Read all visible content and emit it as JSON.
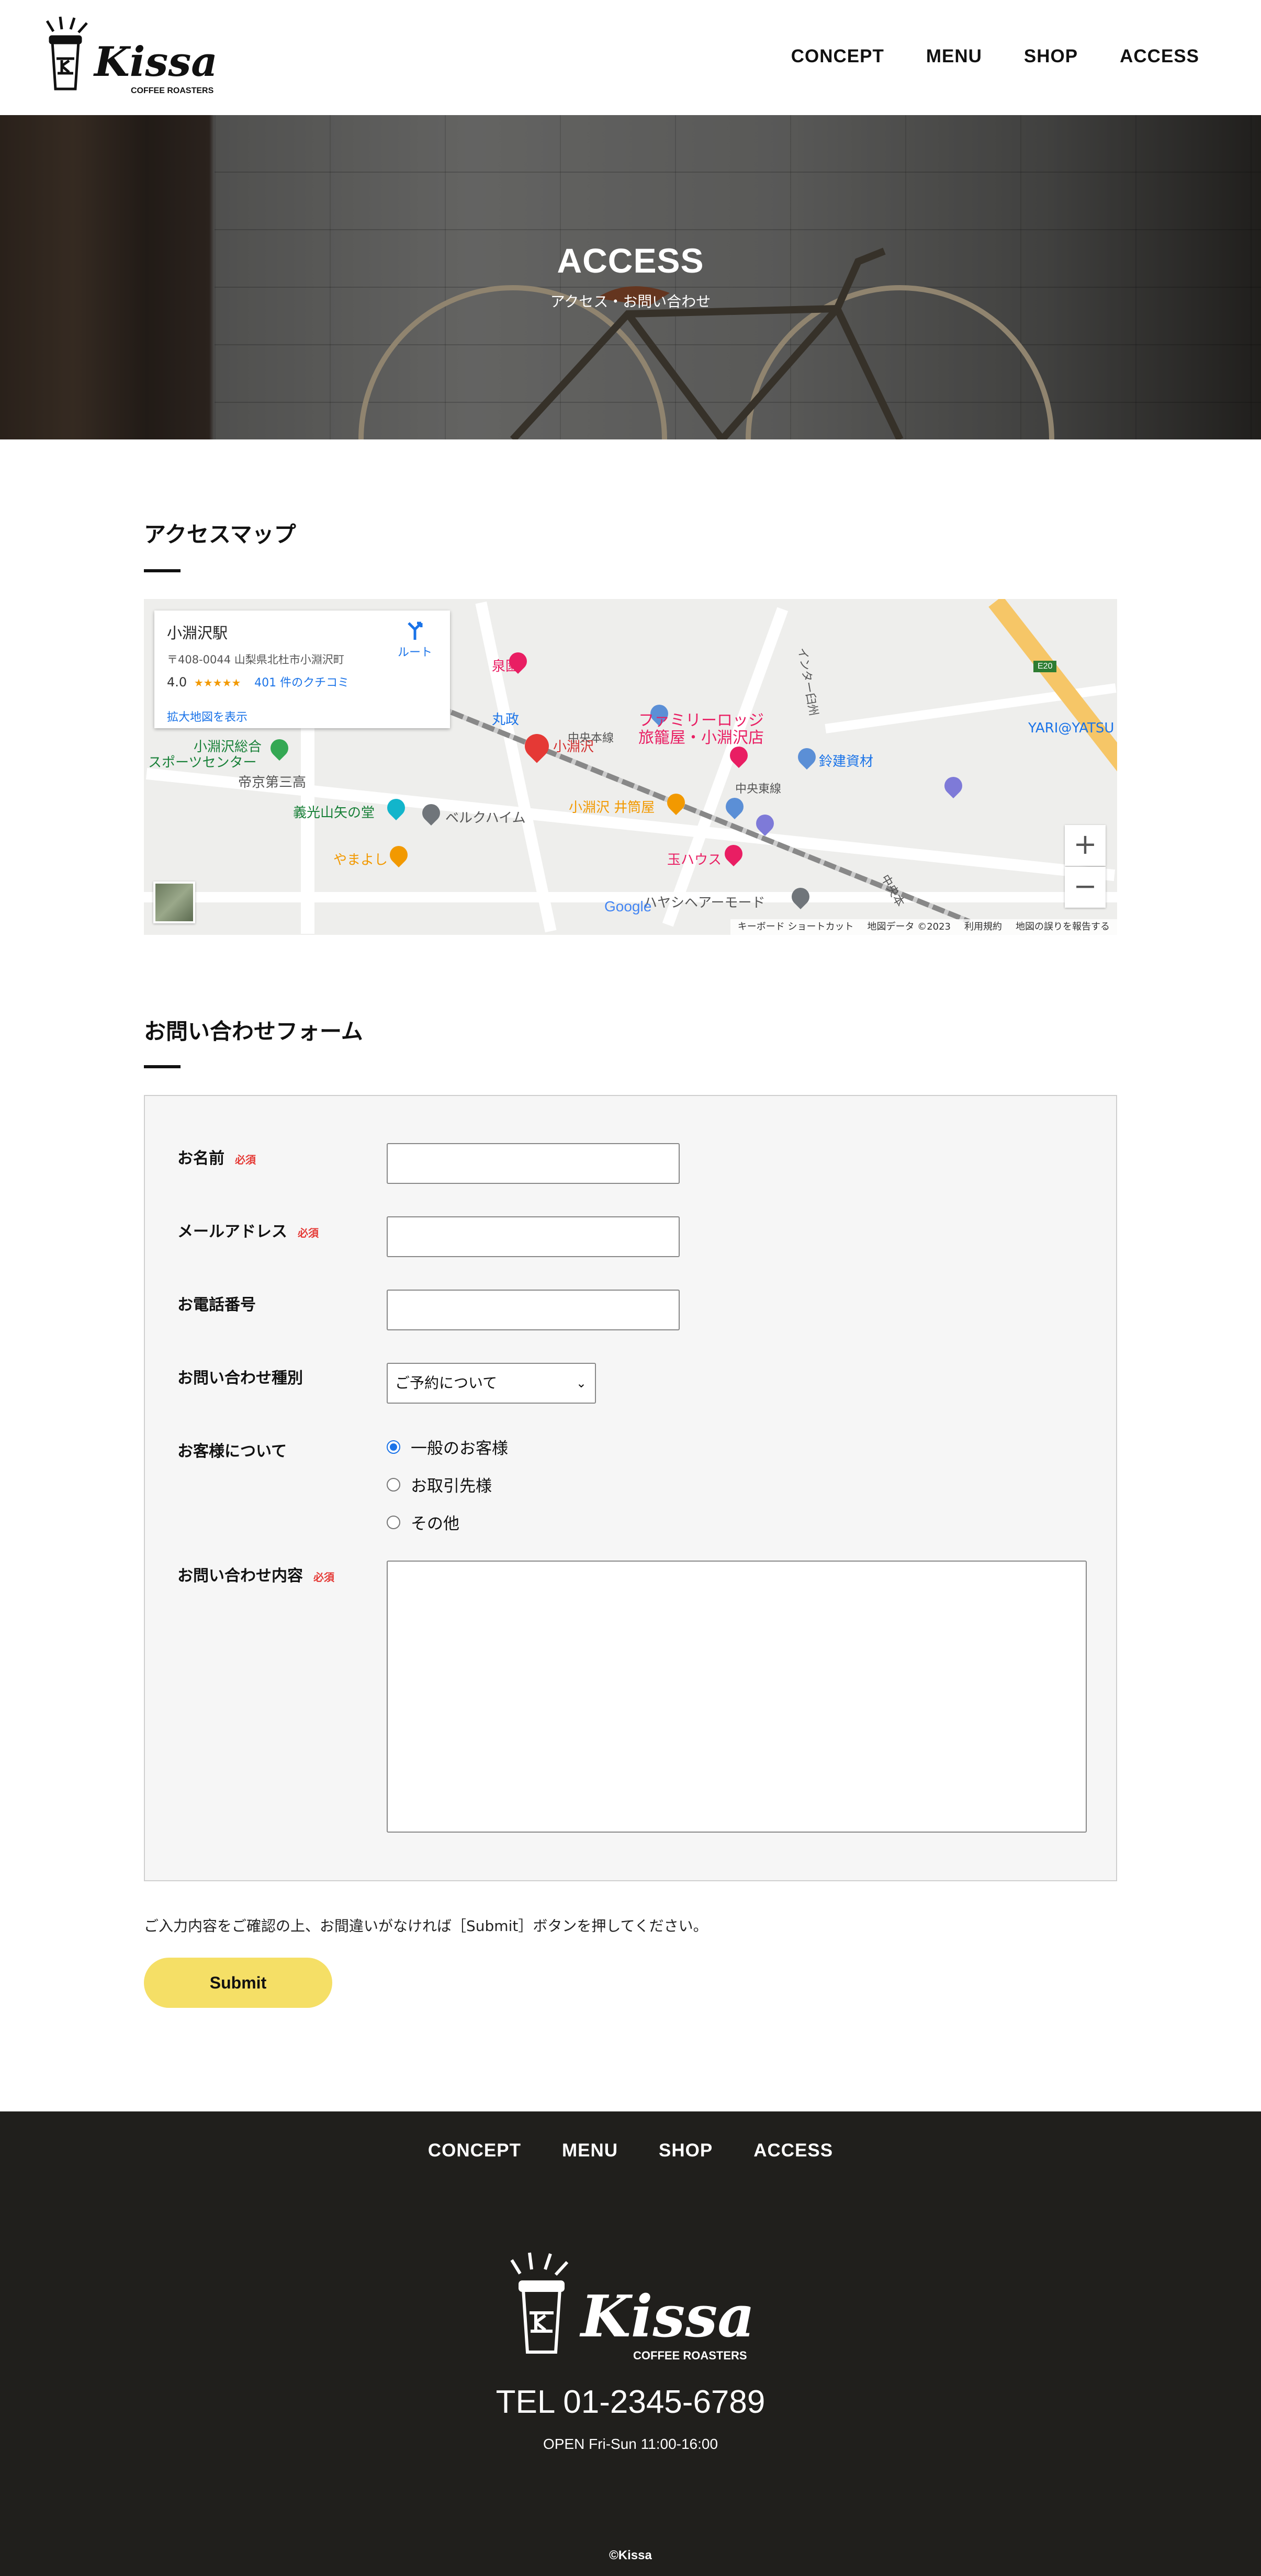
{
  "header": {
    "logo_name": "Kissa",
    "logo_sub": "COFFEE ROASTERS",
    "nav": [
      "CONCEPT",
      "MENU",
      "SHOP",
      "ACCESS"
    ]
  },
  "hero": {
    "title": "ACCESS",
    "subtitle": "アクセス・お問い合わせ"
  },
  "access_map": {
    "title": "アクセスマップ",
    "info": {
      "station": "小淵沢駅",
      "address": "〒408-0044 山梨県北杜市小淵沢町",
      "rating": "4.0",
      "stars": "★★★★★",
      "reviews": "401 件のクチコミ",
      "route": "ルート",
      "enlarge": "拡大地図を表示"
    },
    "labels": {
      "izumi": "泉園",
      "marumasa": "丸政",
      "family_lodge_1": "ファミリーロッジ",
      "family_lodge_2": "旅籠屋・小淵沢店",
      "kobuchizawa": "小淵沢",
      "suzuken": "鈴建資材",
      "chuo_honsen": "中央本線",
      "chuo_tousen": "中央東線",
      "interchange": "インター臼州",
      "yari": "YARI@YATSU",
      "sports_1": "小淵沢総合",
      "sports_2": "スポーツセンター",
      "teikyo": "帝京第三高",
      "yamatoyoshi": "義光山矢の堂",
      "berkheim": "ベルクハイム",
      "izutsuya": "小淵沢 井筒屋",
      "yamayoshi": "やまよし",
      "tamahaus": "玉ハウス",
      "hayashi": "ハヤシヘアーモード",
      "chuo_right": "中央本",
      "e20": "E20",
      "google": "Google",
      "footer_shortcut": "キーボード ショートカット",
      "footer_data": "地図データ ©2023",
      "footer_terms": "利用規約",
      "footer_report": "地図の誤りを報告する"
    },
    "zoom_in": "+",
    "zoom_out": "−"
  },
  "form": {
    "title": "お問い合わせフォーム",
    "required": "必須",
    "name_label": "お名前",
    "email_label": "メールアドレス",
    "phone_label": "お電話番号",
    "type_label": "お問い合わせ種別",
    "type_value": "ご予約について",
    "customer_label": "お客様について",
    "customer_options": [
      "一般のお客様",
      "お取引先様",
      "その他"
    ],
    "content_label": "お問い合わせ内容",
    "confirm_text": "ご入力内容をご確認の上、お間違いがなければ［Submit］ボタンを押してください。",
    "submit": "Submit"
  },
  "footer": {
    "nav": [
      "CONCEPT",
      "MENU",
      "SHOP",
      "ACCESS"
    ],
    "logo_name": "Kissa",
    "logo_sub": "COFFEE ROASTERS",
    "tel": "TEL 01-2345-6789",
    "open": "OPEN Fri-Sun 11:00-16:00",
    "copyright": "©Kissa"
  },
  "colors": {
    "accent_yellow": "#f5df66",
    "footer_bg": "#201f1c",
    "required_red": "#e53935",
    "radio_blue": "#1a73e8"
  }
}
